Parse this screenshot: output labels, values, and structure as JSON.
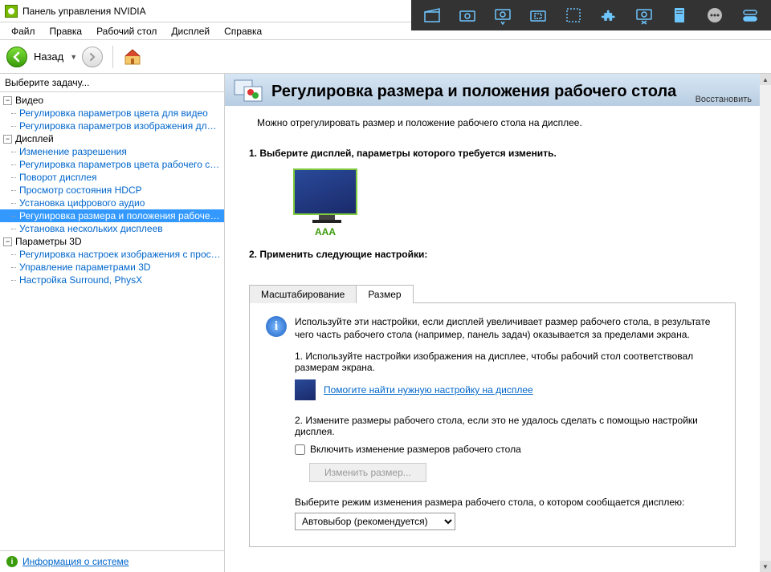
{
  "window": {
    "title": "Панель управления NVIDIA"
  },
  "menu": [
    "Файл",
    "Правка",
    "Рабочий стол",
    "Дисплей",
    "Справка"
  ],
  "nav": {
    "back": "Назад"
  },
  "sidebar": {
    "task_header": "Выберите задачу...",
    "groups": [
      {
        "label": "Видео",
        "items": [
          "Регулировка параметров цвета для видео",
          "Регулировка параметров изображения для видео"
        ]
      },
      {
        "label": "Дисплей",
        "items": [
          "Изменение разрешения",
          "Регулировка параметров цвета рабочего стола",
          "Поворот дисплея",
          "Просмотр состояния HDCP",
          "Установка цифрового аудио",
          "Регулировка размера и положения рабочего стола",
          "Установка нескольких дисплеев"
        ]
      },
      {
        "label": "Параметры 3D",
        "items": [
          "Регулировка настроек изображения с просмотром",
          "Управление параметрами 3D",
          "Настройка Surround, PhysX"
        ]
      }
    ],
    "selected": "Регулировка размера и положения рабочего стола",
    "info_link": "Информация о системе"
  },
  "page": {
    "title": "Регулировка размера и положения рабочего стола",
    "restore": "Восстановить",
    "intro": "Можно отрегулировать размер и положение рабочего стола на дисплее.",
    "section1_h": "1. Выберите дисплей, параметры которого требуется изменить.",
    "display_name": "AAA",
    "section2_h": "2. Применить следующие настройки:",
    "tabs": [
      "Масштабирование",
      "Размер"
    ],
    "active_tab": 1,
    "info_text": "Используйте эти настройки, если дисплей увеличивает размер рабочего стола, в результате чего часть рабочего стола (например, панель задач) оказывается за пределами экрана.",
    "step1": "1. Используйте настройки изображения на дисплее, чтобы рабочий стол соответствовал размерам экрана.",
    "help_link": "Помогите найти нужную настройку на дисплее",
    "step2": "2. Измените размеры рабочего стола, если это не удалось сделать с помощью настройки дисплея.",
    "checkbox_label": "Включить изменение размеров рабочего стола",
    "resize_btn": "Изменить размер...",
    "mode_label": "Выберите режим изменения размера рабочего стола, о котором сообщается дисплею:",
    "mode_value": "Автовыбор (рекомендуется)"
  }
}
